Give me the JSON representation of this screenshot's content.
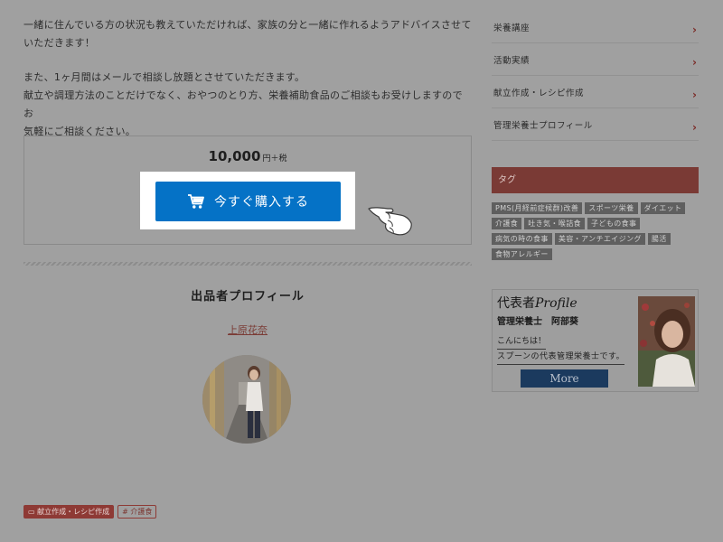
{
  "description": {
    "paragraph1_line1": "一緒に住んでいる方の状況も教えていただければ、家族の分と一緒に作れるようアドバイスさせて",
    "paragraph1_line2": "いただきます！",
    "paragraph2_line1": "また、1ヶ月間はメールで相談し放題とさせていただきます。",
    "paragraph2_line2": "献立や調理方法のことだけでなく、おやつのとり方、栄養補助食品のご相談もお受けしますのでお",
    "paragraph2_line3": "気軽にご相談ください。"
  },
  "purchase": {
    "price": "10,000",
    "tax_suffix": "円＋税",
    "button_label": "今すぐ購入する",
    "button_color": "#0572c6"
  },
  "seller": {
    "heading": "出品者プロフィール",
    "name": "上原花奈"
  },
  "categories": [
    {
      "label": "献立作成・レシピ作成",
      "icon": "folder-icon"
    },
    {
      "label": "介護食",
      "icon": "hash-icon"
    }
  ],
  "sidebar": {
    "menu": [
      {
        "label": "栄養講座"
      },
      {
        "label": "活動実績"
      },
      {
        "label": "献立作成・レシピ作成"
      },
      {
        "label": "管理栄養士プロフィール"
      }
    ],
    "tag_heading": "タグ",
    "tags": [
      "PMS(月経前症候群)改善",
      "スポーツ栄養",
      "ダイエット",
      "介護食",
      "吐き気・喉詰食",
      "子どもの食事",
      "病気の時の食事",
      "美容・アンチエイジング",
      "腸活",
      "食物アレルギー"
    ],
    "banner": {
      "title_jp": "代表者",
      "title_en": "Profile",
      "role": "管理栄養士　阿部葵",
      "greeting_line1": "こんにちは！",
      "greeting_line2": "スプーンの代表管理栄養士です。",
      "more_label": "More"
    }
  },
  "colors": {
    "overlay_bg": "#a0a0a0",
    "accent_red": "#7a3a35",
    "more_button": "#1b3a5e"
  }
}
